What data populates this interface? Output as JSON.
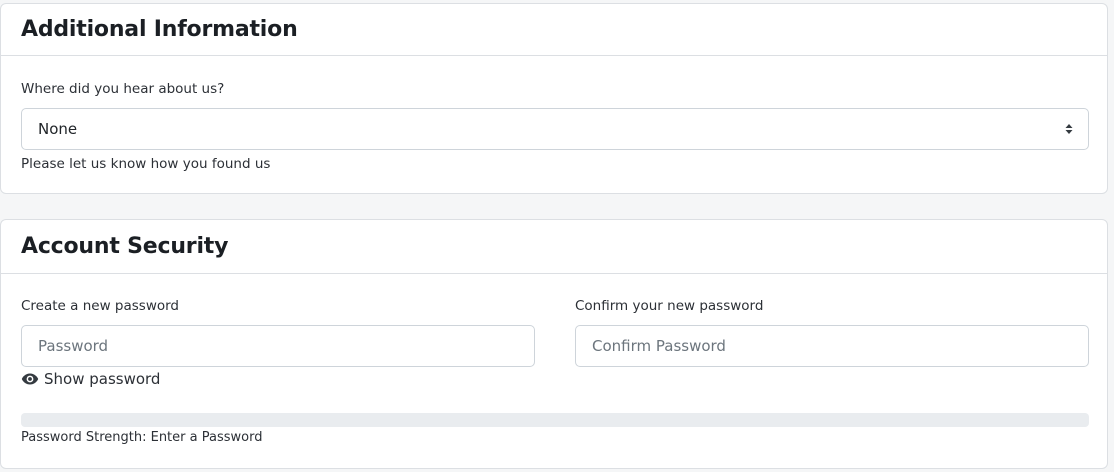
{
  "additional_info": {
    "title": "Additional Information",
    "referral_label": "Where did you hear about us?",
    "referral_selected": "None",
    "referral_help": "Please let us know how you found us"
  },
  "account_security": {
    "title": "Account Security",
    "new_password_label": "Create a new password",
    "new_password_placeholder": "Password",
    "confirm_password_label": "Confirm your new password",
    "confirm_password_placeholder": "Confirm Password",
    "show_password_label": "Show password",
    "strength_text": "Password Strength: Enter a Password",
    "strength_level": 0
  },
  "icons": {
    "select_caret": "sort-caret-icon",
    "show_password": "eye-icon"
  }
}
